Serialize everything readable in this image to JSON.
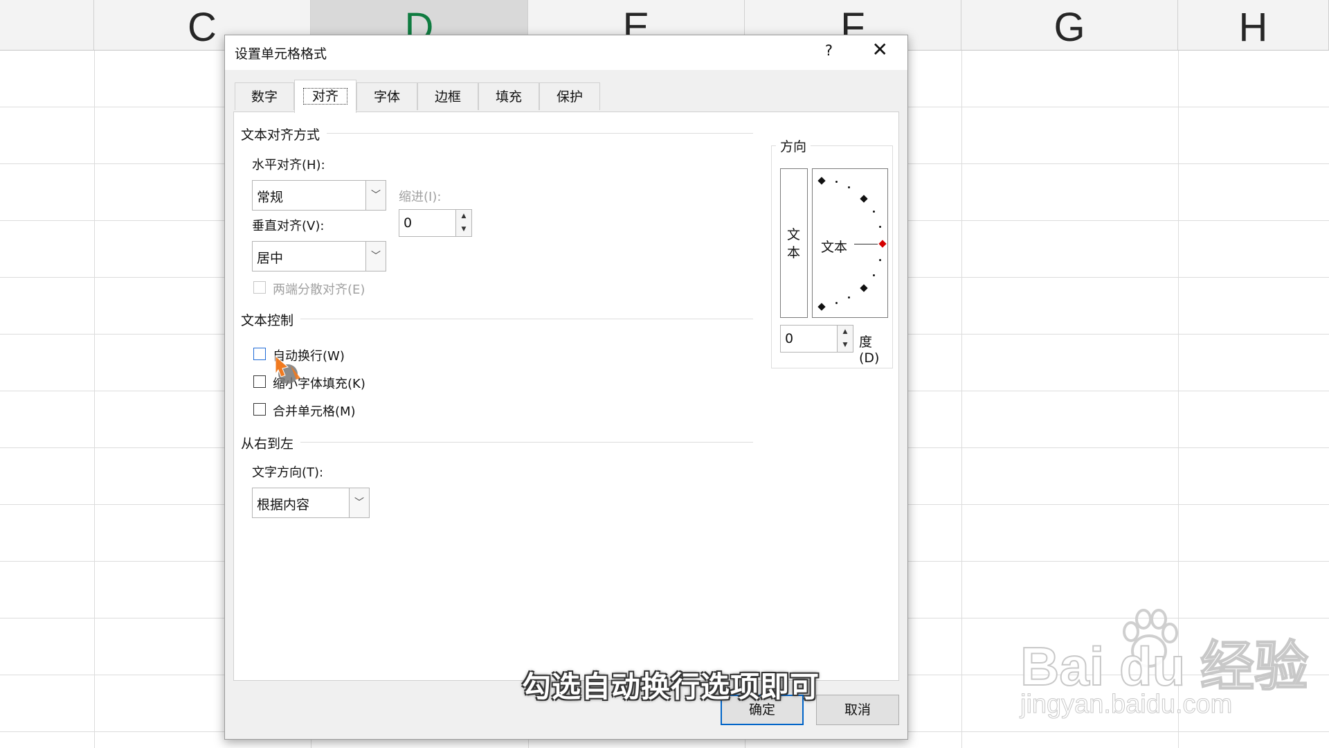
{
  "spreadsheet": {
    "columns": [
      "C",
      "D",
      "E",
      "F",
      "G",
      "H"
    ],
    "selected_column": "D"
  },
  "dialog": {
    "title": "设置单元格格式",
    "help": "?",
    "close": "✕",
    "tabs": [
      {
        "label": "数字",
        "active": false
      },
      {
        "label": "对齐",
        "active": true
      },
      {
        "label": "字体",
        "active": false
      },
      {
        "label": "边框",
        "active": false
      },
      {
        "label": "填充",
        "active": false
      },
      {
        "label": "保护",
        "active": false
      }
    ],
    "text_alignment": {
      "group_title": "文本对齐方式",
      "horizontal_label": "水平对齐(H):",
      "horizontal_value": "常规",
      "indent_label": "缩进(I):",
      "indent_value": "0",
      "vertical_label": "垂直对齐(V):",
      "vertical_value": "居中",
      "justify_distributed_label": "两端分散对齐(E)",
      "justify_distributed_checked": false
    },
    "text_control": {
      "group_title": "文本控制",
      "wrap_text_label": "自动换行(W)",
      "wrap_text_checked": false,
      "shrink_to_fit_label": "缩小字体填充(K)",
      "shrink_to_fit_checked": false,
      "merge_cells_label": "合并单元格(M)",
      "merge_cells_checked": false
    },
    "rtl": {
      "group_title": "从右到左",
      "direction_label": "文字方向(T):",
      "direction_value": "根据内容"
    },
    "orientation": {
      "group_title": "方向",
      "vertical_text": [
        "文",
        "本"
      ],
      "dial_text": "文本",
      "degrees_value": "0",
      "degrees_label": "度(D)"
    },
    "ok_label": "确定",
    "cancel_label": "取消"
  },
  "subtitle": "勾选自动换行选项即可",
  "watermark": {
    "brand": "Bai du 经验",
    "url": "jingyan.baidu.com"
  },
  "colors": {
    "accent_green": "#107c41",
    "focus_blue": "#0064c8",
    "dial_marker_red": "#d40000"
  }
}
